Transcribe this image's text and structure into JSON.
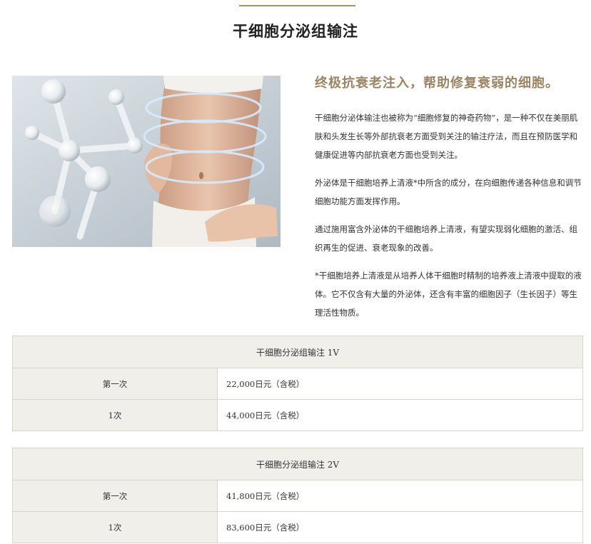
{
  "page_title": "干细胞分泌组输注",
  "headline": "终极抗衰老注入，帮助修复衰弱的细胞。",
  "paragraphs": [
    "干细胞分泌体输注也被称为“细胞修复的神奇药物”，是一种不仅在美丽肌肤和头发生长等外部抗衰老方面受到关注的输注疗法，而且在预防医学和健康促进等内部抗衰老方面也受到关注。",
    "外泌体是干细胞培养上清液*中所含的成分，在向细胞传递各种信息和调节细胞功能方面发挥作用。",
    "通过施用富含外泌体的干细胞培养上清液，有望实现弱化细胞的激活、组织再生的促进、衰老现象的改善。",
    "*干细胞培养上清液是从培养人体干细胞时精制的培养液上清液中提取的液体。它不仅含有大量的外泌体，还含有丰富的细胞因子（生长因子）等生理活性物质。"
  ],
  "price_tables": [
    {
      "header": "干细胞分泌组输注 1V",
      "rows": [
        {
          "label": "第一次",
          "value": "22,000日元（含税）"
        },
        {
          "label": "1次",
          "value": "44,000日元（含税）"
        }
      ]
    },
    {
      "header": "干细胞分泌组输注 2V",
      "rows": [
        {
          "label": "第一次",
          "value": "41,800日元（含税）"
        },
        {
          "label": "1次",
          "value": "83,600日元（含税）"
        }
      ]
    }
  ],
  "image_alt": "abdomen-with-molecule-image",
  "colors": {
    "accent": "#9a8463",
    "rule": "#a58f6e",
    "table_header_bg": "#f1efe9",
    "table_border": "#d8d4cc",
    "text": "#333333"
  }
}
